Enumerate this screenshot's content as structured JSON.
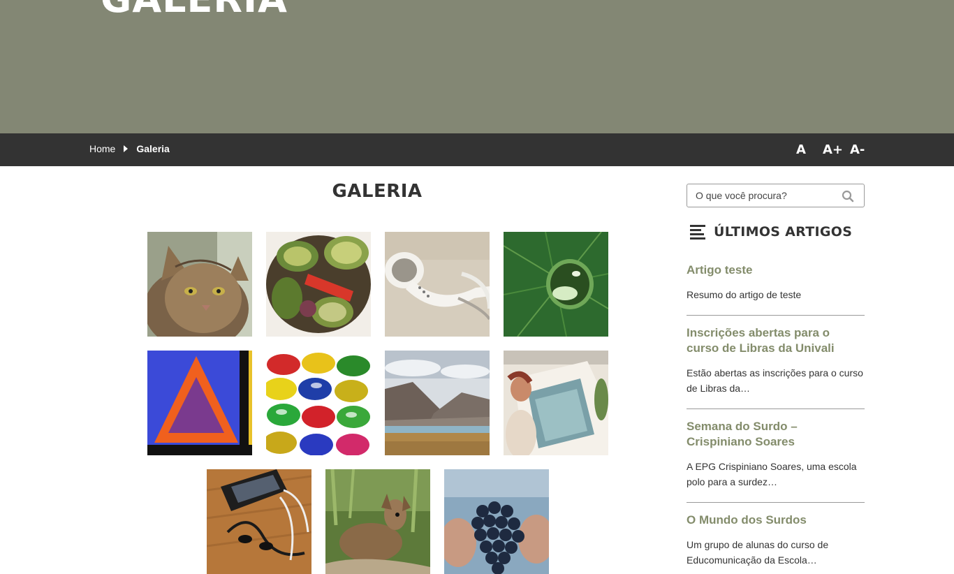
{
  "hero": {
    "title": "GALERIA",
    "bg_color": "#838774"
  },
  "breadcrumb": {
    "home": "Home",
    "current": "Galeria"
  },
  "font_controls": {
    "normal": "A",
    "increase": "A+",
    "decrease": "A-"
  },
  "page": {
    "title": "GALERIA"
  },
  "gallery": {
    "images": [
      "cat",
      "grilled-vegetables",
      "earphones",
      "water-drop-on-leaf",
      "triangle-sign",
      "colored-glass-beads",
      "mountain-lake",
      "person-at-car-door",
      "phone-with-earphones",
      "deer-in-forest",
      "grapes-in-hands"
    ]
  },
  "sidebar": {
    "search_placeholder": "O que você procura?",
    "widget_title": "ÚLTIMOS ARTIGOS",
    "articles": [
      {
        "title": "Artigo teste",
        "excerpt": "Resumo do artigo de teste"
      },
      {
        "title": "Inscrições abertas para o curso de Libras da Univali",
        "excerpt": "Estão abertas as inscrições para o curso de Libras da…"
      },
      {
        "title": "Semana do Surdo – Crispiniano Soares",
        "excerpt": "A EPG Crispiniano Soares, uma escola polo para a surdez…"
      },
      {
        "title": "O Mundo dos Surdos",
        "excerpt": "Um grupo de alunas do curso de Educomunicação da Escola…"
      }
    ]
  },
  "colors": {
    "accent": "#838c6b",
    "bar": "#333333"
  }
}
